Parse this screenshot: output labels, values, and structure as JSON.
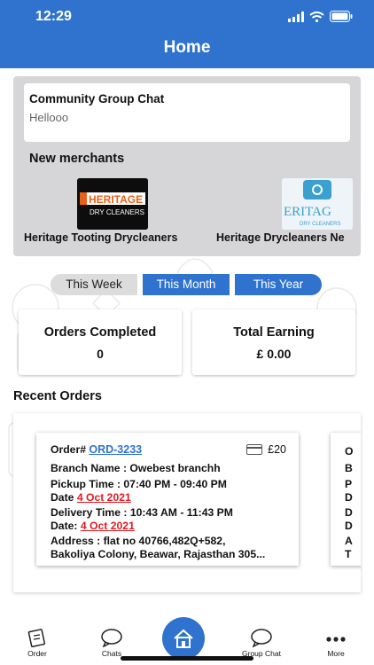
{
  "status_bar": {
    "time": "12:29"
  },
  "header": {
    "title": "Home"
  },
  "community": {
    "title": "Community Group Chat",
    "last_message": "Hellooo"
  },
  "merchants": {
    "heading": "New merchants",
    "items": [
      {
        "name": "Heritage Tooting Drycleaners",
        "logo_text": "HERITAGE",
        "logo_subtext": "DRY CLEANERS"
      },
      {
        "name": "Heritage Drycleaners Ne",
        "logo_text": "ERITAG",
        "logo_subtext": "DRY CLEANERS"
      }
    ]
  },
  "period_tabs": {
    "week": "This Week",
    "month": "This Month",
    "year": "This Year",
    "selected": [
      "This Month",
      "This Year"
    ]
  },
  "stats": {
    "orders_completed_label": "Orders Completed",
    "orders_completed_value": "0",
    "total_earning_label": "Total Earning",
    "total_earning_value": "£ 0.00"
  },
  "recent_orders": {
    "heading": "Recent Orders",
    "order": {
      "order_label": "Order# ",
      "order_number": "ORD-3233",
      "amount": "£20",
      "branch": "Branch Name : Owebest branchh",
      "pickup_time": "Pickup Time : 07:40 PM - 09:40 PM",
      "pickup_date_label": "Date ",
      "pickup_date": "4 Oct 2021",
      "delivery_time": "Delivery Time : 10:43 AM - 11:43 PM",
      "delivery_date_label": "Date: ",
      "delivery_date": "4 Oct 2021",
      "address_line1": "Address : flat no 40766,482Q+582,",
      "address_line2": "Bakoliya Colony, Beawar, Rajasthan 305..."
    },
    "peek_letters": [
      "O",
      "B",
      "P",
      "D",
      "D",
      "D",
      "A",
      "T"
    ]
  },
  "bottom_nav": {
    "order": "Order",
    "chats": "Chats",
    "group_chat": "Group Chat",
    "more": "More"
  },
  "colors": {
    "primary": "#2f73cf",
    "tab_inactive": "#dcdcdc",
    "date_red": "#e11b22",
    "panel_gray": "#d6d6d9"
  },
  "icons": [
    "wifi-icon",
    "battery-icon",
    "signal-icon",
    "card-icon",
    "order-icon",
    "chat-icon",
    "home-icon",
    "group-chat-icon",
    "more-icon"
  ]
}
